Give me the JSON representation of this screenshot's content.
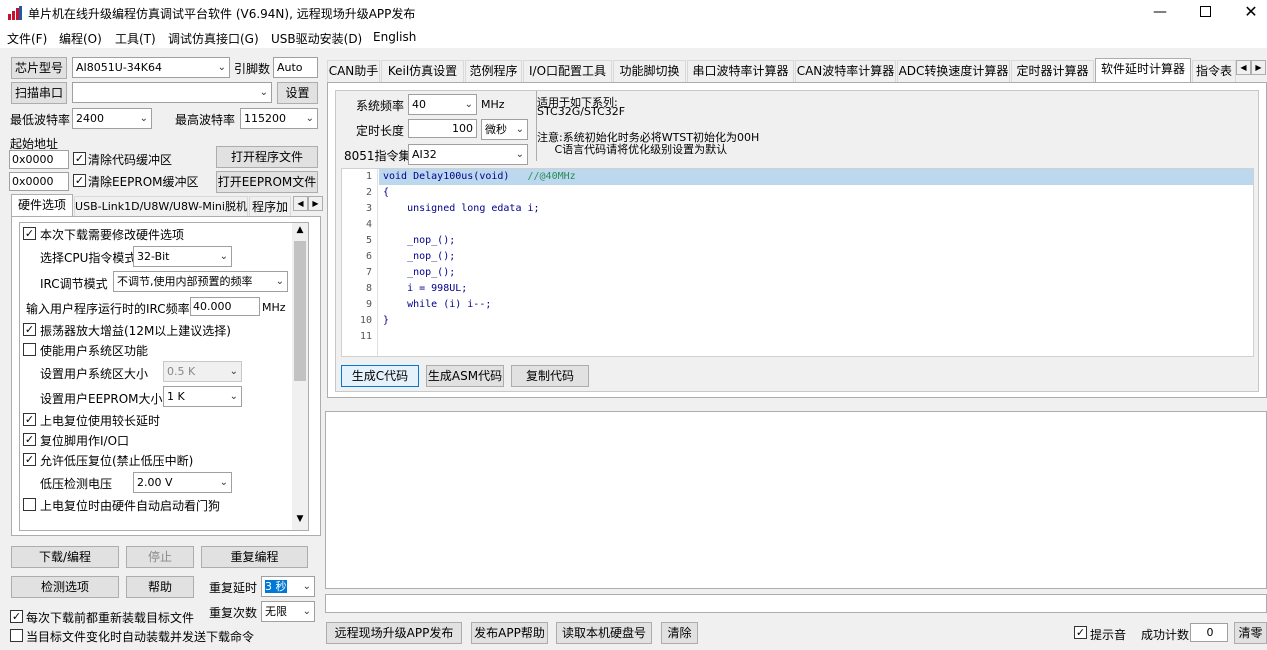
{
  "window": {
    "title": "单片机在线升级编程仿真调试平台软件 (V6.94N), 远程现场升级APP发布"
  },
  "menu": [
    "文件(F)",
    "编程(O)",
    "工具(T)",
    "调试仿真接口(G)",
    "USB驱动安装(D)",
    "English"
  ],
  "left": {
    "chip_model_btn": "芯片型号",
    "chip_model": "AI8051U-34K64",
    "pin_count_label": "引脚数",
    "pin_count": "Auto",
    "scan_port_btn": "扫描串口",
    "port_value": "",
    "settings_btn": "设置",
    "min_baud_label": "最低波特率",
    "min_baud": "2400",
    "max_baud_label": "最高波特率",
    "max_baud": "115200",
    "start_addr_label": "起始地址",
    "addr1": "0x0000",
    "clear_code_buf": "清除代码缓冲区",
    "open_program_btn": "打开程序文件",
    "addr2": "0x0000",
    "clear_eeprom_buf": "清除EEPROM缓冲区",
    "open_eeprom_btn": "打开EEPROM文件",
    "tabs": [
      "硬件选项",
      "USB-Link1D/U8W/U8W-Mini脱机",
      "程序加"
    ],
    "hw": {
      "modify_hw": "本次下载需要修改硬件选项",
      "cpu_mode_label": "选择CPU指令模式",
      "cpu_mode": "32-Bit",
      "irc_mode_label": "IRC调节模式",
      "irc_mode": "不调节,使用内部预置的频率",
      "irc_freq_label": "输入用户程序运行时的IRC频率",
      "irc_freq": "40.000",
      "irc_unit": "MHz",
      "osc_gain": "振荡器放大增益(12M以上建议选择)",
      "enable_sys_area": "使能用户系统区功能",
      "sys_area_size_label": "设置用户系统区大小",
      "sys_area_size": "0.5 K",
      "eeprom_size_label": "设置用户EEPROM大小",
      "eeprom_size": "1   K",
      "long_delay": "上电复位使用较长延时",
      "reset_pin_io": "复位脚用作I/O口",
      "low_volt_reset": "允许低压复位(禁止低压中断)",
      "low_volt_label": "低压检测电压",
      "low_volt": "2.00 V",
      "wdt_auto": "上电复位时由硬件自动启动看门狗"
    },
    "download_btn": "下载/编程",
    "stop_btn": "停止",
    "reprogram_btn": "重复编程",
    "check_btn": "检测选项",
    "help_btn": "帮助",
    "repeat_delay_label": "重复延时",
    "repeat_delay": "3 秒",
    "repeat_count_label": "重复次数",
    "repeat_count": "无限",
    "reload_each": "每次下载前都重新装载目标文件",
    "auto_on_change": "当目标文件变化时自动装载并发送下载命令"
  },
  "right": {
    "tabs": [
      "CAN助手",
      "Keil仿真设置",
      "范例程序",
      "I/O口配置工具",
      "功能脚切换",
      "串口波特率计算器",
      "CAN波特率计算器",
      "ADC转换速度计算器",
      "定时器计算器",
      "软件延时计算器",
      "指令表"
    ],
    "sys_freq_label": "系统频率",
    "sys_freq": "40",
    "sys_freq_unit": "MHz",
    "time_len_label": "定时长度",
    "time_len": "100",
    "time_unit": "微秒",
    "instr_set_label": "8051指令集",
    "instr_set": "AI32",
    "info": [
      "适用于如下系列:",
      "STC32G/STC32F",
      "",
      "注意:系统初始化时务必将WTST初始化为00H",
      "     C语言代码请将优化级别设置为默认"
    ],
    "code": [
      "void Delay100us(void)   //@40MHz",
      "{",
      "    unsigned long edata i;",
      "",
      "    _nop_();",
      "    _nop_();",
      "    _nop_();",
      "    i = 998UL;",
      "    while (i) i--;",
      "}",
      ""
    ],
    "gen_c_btn": "生成C代码",
    "gen_asm_btn": "生成ASM代码",
    "copy_btn": "复制代码"
  },
  "bottom": {
    "publish_btn": "远程现场升级APP发布",
    "publish_help_btn": "发布APP帮助",
    "read_disk_btn": "读取本机硬盘号",
    "clear_btn": "清除",
    "beep_label": "提示音",
    "success_label": "成功计数",
    "success_count": "0",
    "reset_btn": "清零"
  }
}
